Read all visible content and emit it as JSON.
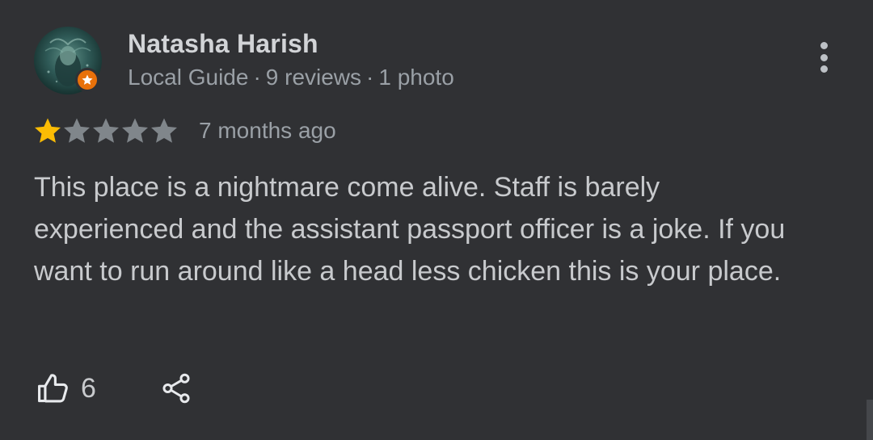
{
  "reviewer": {
    "name": "Natasha Harish",
    "badge": "Local Guide",
    "reviews": "9 reviews",
    "photos": "1 photo",
    "separator": "·",
    "avatar_icon": "avatar-photo",
    "badge_color": "#e8710a"
  },
  "rating": {
    "value": 1,
    "max": 5,
    "filled_color": "#fbbc04",
    "empty_color": "#80868b",
    "time": "7 months ago"
  },
  "review_text": "This place is a nightmare come alive. Staff is barely experienced and the assistant passport officer is a joke. If you want to run around like a head less chicken this is your place.",
  "actions": {
    "like_icon": "thumbs-up-icon",
    "like_count": "6",
    "share_icon": "share-icon",
    "more_icon": "more-vert-icon"
  }
}
